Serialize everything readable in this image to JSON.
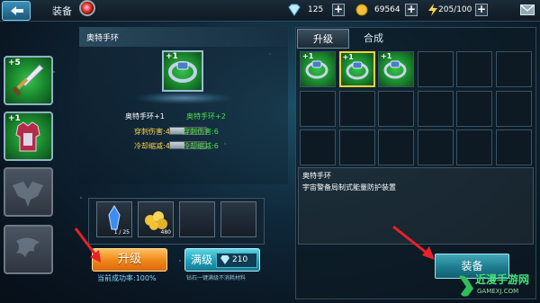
{
  "top_bar": {
    "title": "装备",
    "diamonds": "125",
    "gold": "69564",
    "energy": "205/100"
  },
  "left_slots": [
    {
      "plus": "+5",
      "item": "sword"
    },
    {
      "plus": "+1",
      "item": "armor"
    },
    {
      "plus": "",
      "item": "empty"
    },
    {
      "plus": "",
      "item": "empty"
    }
  ],
  "center": {
    "item_header": "奥特手环",
    "featured_plus": "+1",
    "name_current": "奥特手环+1",
    "name_next": "奥特手环+2",
    "stats": [
      {
        "label": "穿刺伤害:4",
        "next": "穿刺伤害:6",
        "fill": 0.4
      },
      {
        "label": "冷却缩减:4",
        "next": "冷却缩减:6",
        "fill": 0.4
      }
    ]
  },
  "materials": [
    {
      "count": "1 / 25",
      "kind": "crystal"
    },
    {
      "count": "480",
      "kind": "gold-pile"
    },
    {
      "count": "",
      "kind": "empty"
    },
    {
      "count": "",
      "kind": "empty"
    }
  ],
  "buttons": {
    "upgrade": "升级",
    "upgrade_rate": "当前成功率:100%",
    "max_label": "满级",
    "max_price": "210",
    "max_note": "钻石一键满级不消耗材料",
    "equip": "装备"
  },
  "tabs": {
    "upgrade": "升级",
    "synthesize": "合成"
  },
  "inventory": [
    {
      "plus": "+1",
      "filled": true,
      "selected": false
    },
    {
      "plus": "+1",
      "filled": true,
      "selected": true
    },
    {
      "plus": "+1",
      "filled": true,
      "selected": false
    }
  ],
  "description": {
    "name": "奥特手环",
    "text": "宇宙警备局制式能量防护装置"
  },
  "watermark": {
    "main": "近漫手游网",
    "sub": "GAMEXJ.COM"
  },
  "colors": {
    "accent_cyan": "#1f9fb9",
    "accent_orange": "#f08a1c",
    "item_green": "#36c04a",
    "stat_green": "#4be04a",
    "stat_yellow": "#ffd64a"
  }
}
